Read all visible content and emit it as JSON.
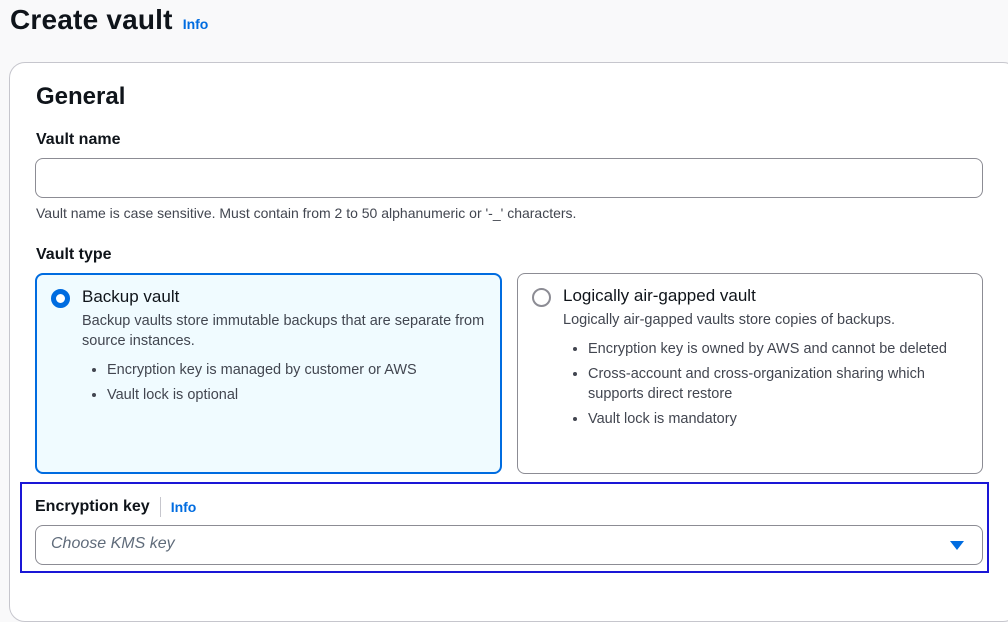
{
  "header": {
    "title": "Create vault",
    "info_label": "Info"
  },
  "general": {
    "title": "General",
    "vault_name": {
      "label": "Vault name",
      "value": "",
      "placeholder": "",
      "hint": "Vault name is case sensitive. Must contain from 2 to 50 alphanumeric or '-_' characters."
    },
    "vault_type": {
      "label": "Vault type",
      "options": [
        {
          "title": "Backup vault",
          "description": "Backup vaults store immutable backups that are separate from source instances.",
          "bullets": [
            "Encryption key is managed by customer or AWS",
            "Vault lock is optional"
          ],
          "selected": true
        },
        {
          "title": "Logically air-gapped vault",
          "description": "Logically air-gapped vaults store copies of backups.",
          "bullets": [
            "Encryption key is owned by AWS and cannot be deleted",
            "Cross-account and cross-organization sharing which supports direct restore",
            "Vault lock is mandatory"
          ],
          "selected": false
        }
      ]
    },
    "encryption_key": {
      "label": "Encryption key",
      "info_label": "Info",
      "placeholder": "Choose KMS key"
    }
  },
  "colors": {
    "accent": "#006ce0",
    "highlight_border": "#1a17d6",
    "selected_tile_bg": "#f0fbff"
  }
}
